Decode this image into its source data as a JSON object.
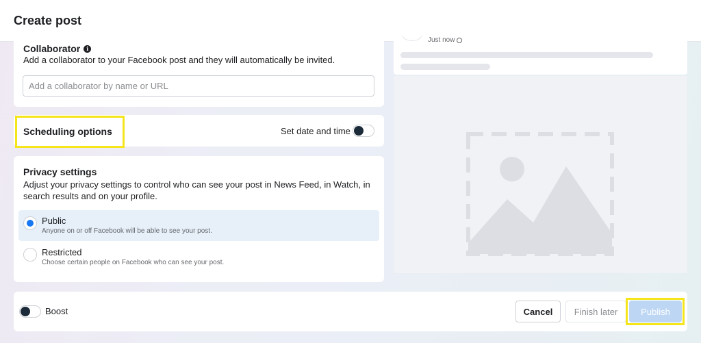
{
  "header": {
    "title": "Create post"
  },
  "collaborator": {
    "title": "Collaborator",
    "info_icon": "info-icon",
    "description": "Add a collaborator to your Facebook post and they will automatically be invited.",
    "input_placeholder": "Add a collaborator by name or URL",
    "input_value": ""
  },
  "scheduling": {
    "title": "Scheduling options",
    "toggle_label": "Set date and time",
    "toggle_on": false
  },
  "privacy": {
    "title": "Privacy settings",
    "description": "Adjust your privacy settings to control who can see your post in News Feed, in Watch, in search results and on your profile.",
    "options": [
      {
        "label": "Public",
        "sub": "Anyone on or off Facebook will be able to see your post.",
        "selected": true
      },
      {
        "label": "Restricted",
        "sub": "Choose certain people on Facebook who can see your post.",
        "selected": false
      }
    ]
  },
  "preview": {
    "timestamp": "Just now",
    "privacy_icon": "globe-icon",
    "media_icon": "image-placeholder-icon"
  },
  "footer": {
    "boost_label": "Boost",
    "boost_on": false,
    "cancel_label": "Cancel",
    "finish_later_label": "Finish later",
    "publish_label": "Publish"
  },
  "colors": {
    "accent": "#1877f2",
    "highlight": "#f5e51b",
    "publish_disabled": "#bcd6f4",
    "selected_row": "#e7f0f9"
  }
}
